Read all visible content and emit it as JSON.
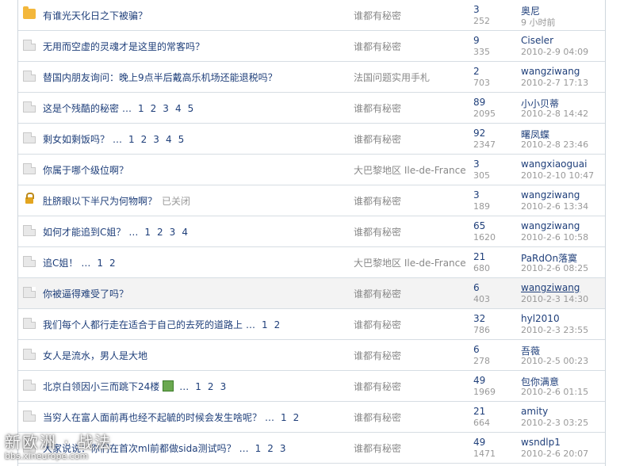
{
  "threads": [
    {
      "icon": "folder-icon",
      "title": "有谁光天化日之下被骗？",
      "pages": [],
      "closed": "",
      "forum": "谁都有秘密",
      "replies": "3",
      "views": "252",
      "user": "奥尼",
      "time": "9 小时前"
    },
    {
      "icon": "doc-icon",
      "title": "无用而空虚的灵魂才是这里的常客吗？",
      "pages": [],
      "closed": "",
      "forum": "谁都有秘密",
      "replies": "9",
      "views": "335",
      "user": "Ciseler",
      "time": "2010-2-9 04:09"
    },
    {
      "icon": "doc-icon",
      "title": "替国内朋友询问：晚上9点半后戴高乐机场还能退税吗？",
      "pages": [],
      "closed": "",
      "forum": "法国问题实用手札",
      "replies": "2",
      "views": "703",
      "user": "wangziwang",
      "time": "2010-2-7 17:13"
    },
    {
      "icon": "doc-icon",
      "title": "这是个残酷的秘密",
      "pages": [
        "1",
        "2",
        "3",
        "4",
        "5"
      ],
      "closed": "",
      "forum": "谁都有秘密",
      "replies": "89",
      "views": "2095",
      "user": "小小贝蒂",
      "time": "2010-2-8 14:42"
    },
    {
      "icon": "doc-icon",
      "title": "剩女如剩饭吗？",
      "pages": [
        "1",
        "2",
        "3",
        "4",
        "5"
      ],
      "closed": "",
      "forum": "谁都有秘密",
      "replies": "92",
      "views": "2347",
      "user": "曙凤蝶",
      "time": "2010-2-8 23:46"
    },
    {
      "icon": "doc-icon",
      "title": "你属于哪个级位啊？",
      "pages": [],
      "closed": "",
      "forum": "大巴黎地区 Ile-de-France",
      "replies": "3",
      "views": "305",
      "user": "wangxiaoguai",
      "time": "2010-2-10 10:47"
    },
    {
      "icon": "lock-icon",
      "title": "肚脐眼以下半尺为何物啊？",
      "pages": [],
      "closed": "已关闭",
      "forum": "谁都有秘密",
      "replies": "3",
      "views": "189",
      "user": "wangziwang",
      "time": "2010-2-6 13:34"
    },
    {
      "icon": "doc-icon",
      "title": "如何才能追到C姐？",
      "pages": [
        "1",
        "2",
        "3",
        "4"
      ],
      "closed": "",
      "forum": "谁都有秘密",
      "replies": "65",
      "views": "1620",
      "user": "wangziwang",
      "time": "2010-2-6 10:58"
    },
    {
      "icon": "doc-icon",
      "title": "追C姐！",
      "pages": [
        "1",
        "2"
      ],
      "closed": "",
      "forum": "大巴黎地区 Ile-de-France",
      "replies": "21",
      "views": "680",
      "user": "PaRdOn落寞",
      "time": "2010-2-6 08:25"
    },
    {
      "icon": "doc-icon",
      "title": "你被逼得难受了吗？",
      "pages": [],
      "closed": "",
      "forum": "谁都有秘密",
      "replies": "6",
      "views": "403",
      "user": "wangziwang",
      "time": "2010-2-3 14:30",
      "highlight": true
    },
    {
      "icon": "doc-icon",
      "title": "我们每个人都行走在适合于自己的去死的道路上",
      "pages": [
        "1",
        "2"
      ],
      "closed": "",
      "forum": "谁都有秘密",
      "replies": "32",
      "views": "786",
      "user": "hyl2010",
      "time": "2010-2-3 23:55"
    },
    {
      "icon": "doc-icon",
      "title": "女人是流水，男人是大地",
      "pages": [],
      "closed": "",
      "forum": "谁都有秘密",
      "replies": "6",
      "views": "278",
      "user": "吾薇",
      "time": "2010-2-5 00:23"
    },
    {
      "icon": "doc-icon",
      "title": "北京白领因小三而跳下24楼",
      "pages": [
        "1",
        "2",
        "3"
      ],
      "closed": "",
      "hasImage": true,
      "forum": "谁都有秘密",
      "replies": "49",
      "views": "1969",
      "user": "包你满意",
      "time": "2010-2-6 01:15"
    },
    {
      "icon": "doc-icon",
      "title": "当穷人在富人面前再也经不起毓的时候会发生啥呢？",
      "pages": [
        "1",
        "2"
      ],
      "closed": "",
      "forum": "谁都有秘密",
      "replies": "21",
      "views": "664",
      "user": "amity",
      "time": "2010-2-3 03:25"
    },
    {
      "icon": "doc-icon",
      "title": "大家说说：你们在首次ml前都做sida测试吗？",
      "pages": [
        "1",
        "2",
        "3"
      ],
      "closed": "",
      "forum": "谁都有秘密",
      "replies": "49",
      "views": "1471",
      "user": "wsndlp1",
      "time": "2010-2-6 20:07"
    }
  ],
  "watermark": {
    "brand": "新欧洲 · 战法",
    "url": "bbs.xineurope.com"
  }
}
